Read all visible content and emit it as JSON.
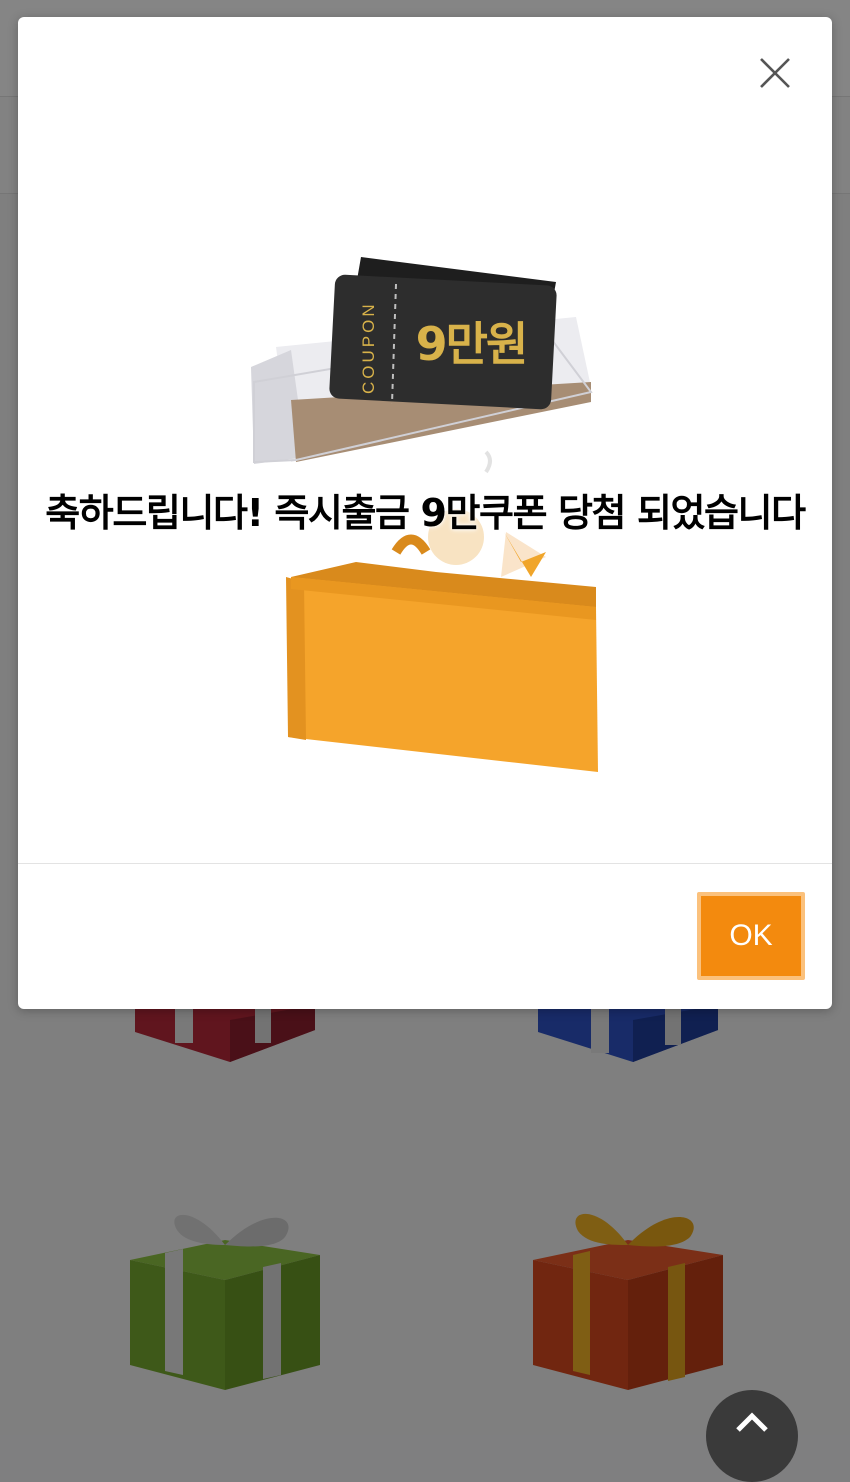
{
  "modal": {
    "message": "축하드립니다! 즉시출금 9만쿠폰 당첨 되었습니다",
    "ok_label": "OK",
    "close_icon": "close-icon"
  },
  "coupon": {
    "side_text": "COUPON",
    "amount": "9만원"
  },
  "background": {
    "gifts": [
      "red-gift-box",
      "blue-gift-box",
      "green-gift-box",
      "orange-gift-box"
    ],
    "scroll_top_icon": "chevron-up-icon"
  },
  "colors": {
    "ok_button": "#f38a0e",
    "ok_border": "#fbc17c",
    "overlay": "#7f7f80",
    "box_orange": "#f5a42b",
    "coupon_dark": "#2a2a2a",
    "coupon_gold": "#d8b24a"
  }
}
